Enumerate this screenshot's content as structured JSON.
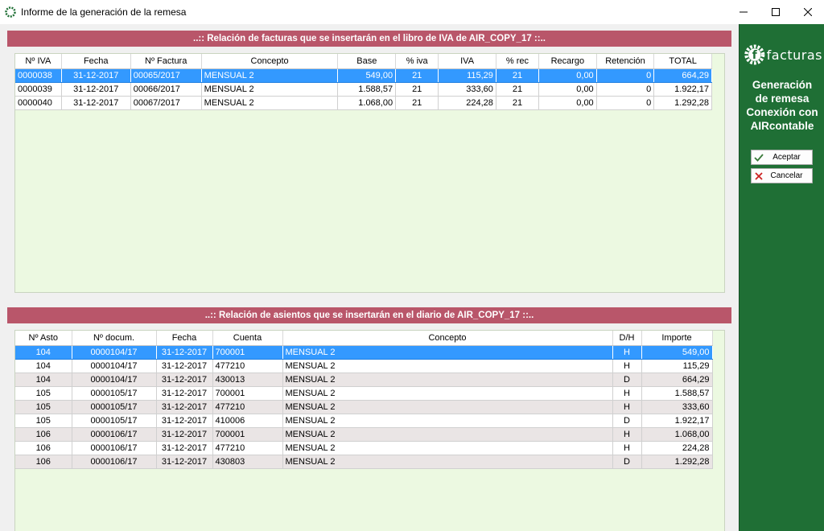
{
  "window": {
    "title": "Informe de la generación de la remesa",
    "controls": [
      "minimize",
      "maximize",
      "close"
    ]
  },
  "facturas_section": {
    "header": "..:: Relación de facturas que se insertarán en el libro de IVA de AIR_COPY_17 ::..",
    "columns": [
      "Nº IVA",
      "Fecha",
      "Nº Factura",
      "Concepto",
      "Base",
      "% iva",
      "IVA",
      "% rec",
      "Recargo",
      "Retención",
      "TOTAL"
    ],
    "rows": [
      {
        "num_iva": "0000038",
        "fecha": "31-12-2017",
        "num_factura": "00065/2017",
        "concepto": "MENSUAL 2",
        "base": "549,00",
        "pct_iva": "21",
        "iva": "115,29",
        "pct_rec": "21",
        "recargo": "0,00",
        "retencion": "0",
        "total": "664,29",
        "selected": true
      },
      {
        "num_iva": "0000039",
        "fecha": "31-12-2017",
        "num_factura": "00066/2017",
        "concepto": "MENSUAL 2",
        "base": "1.588,57",
        "pct_iva": "21",
        "iva": "333,60",
        "pct_rec": "21",
        "recargo": "0,00",
        "retencion": "0",
        "total": "1.922,17",
        "selected": false
      },
      {
        "num_iva": "0000040",
        "fecha": "31-12-2017",
        "num_factura": "00067/2017",
        "concepto": "MENSUAL 2",
        "base": "1.068,00",
        "pct_iva": "21",
        "iva": "224,28",
        "pct_rec": "21",
        "recargo": "0,00",
        "retencion": "0",
        "total": "1.292,28",
        "selected": false
      }
    ]
  },
  "asientos_section": {
    "header": "..:: Relación de asientos que se insertarán en el diario de AIR_COPY_17 ::..",
    "columns": [
      "Nº Asto",
      "Nº docum.",
      "Fecha",
      "Cuenta",
      "Concepto",
      "D/H",
      "Importe"
    ],
    "rows": [
      {
        "asto": "104",
        "docum": "0000104/17",
        "fecha": "31-12-2017",
        "cuenta": "700001",
        "concepto": "MENSUAL 2",
        "dh": "H",
        "importe": "549,00",
        "selected": true
      },
      {
        "asto": "104",
        "docum": "0000104/17",
        "fecha": "31-12-2017",
        "cuenta": "477210",
        "concepto": "MENSUAL 2",
        "dh": "H",
        "importe": "115,29",
        "selected": false
      },
      {
        "asto": "104",
        "docum": "0000104/17",
        "fecha": "31-12-2017",
        "cuenta": "430013",
        "concepto": "MENSUAL 2",
        "dh": "D",
        "importe": "664,29",
        "selected": false
      },
      {
        "asto": "105",
        "docum": "0000105/17",
        "fecha": "31-12-2017",
        "cuenta": "700001",
        "concepto": "MENSUAL 2",
        "dh": "H",
        "importe": "1.588,57",
        "selected": false
      },
      {
        "asto": "105",
        "docum": "0000105/17",
        "fecha": "31-12-2017",
        "cuenta": "477210",
        "concepto": "MENSUAL 2",
        "dh": "H",
        "importe": "333,60",
        "selected": false
      },
      {
        "asto": "105",
        "docum": "0000105/17",
        "fecha": "31-12-2017",
        "cuenta": "410006",
        "concepto": "MENSUAL 2",
        "dh": "D",
        "importe": "1.922,17",
        "selected": false
      },
      {
        "asto": "106",
        "docum": "0000106/17",
        "fecha": "31-12-2017",
        "cuenta": "700001",
        "concepto": "MENSUAL 2",
        "dh": "H",
        "importe": "1.068,00",
        "selected": false
      },
      {
        "asto": "106",
        "docum": "0000106/17",
        "fecha": "31-12-2017",
        "cuenta": "477210",
        "concepto": "MENSUAL 2",
        "dh": "H",
        "importe": "224,28",
        "selected": false
      },
      {
        "asto": "106",
        "docum": "0000106/17",
        "fecha": "31-12-2017",
        "cuenta": "430803",
        "concepto": "MENSUAL 2",
        "dh": "D",
        "importe": "1.292,28",
        "selected": false
      }
    ]
  },
  "sidebar": {
    "logo_text": "facturas",
    "title_lines": [
      "Generación",
      "de remesa",
      "Conexión con",
      "AIRcontable"
    ],
    "accept_label": "Aceptar",
    "cancel_label": "Cancelar",
    "accept_icon": "checkmark-icon",
    "cancel_icon": "x-icon"
  },
  "colors": {
    "header_bar": "#b9566a",
    "sidebar": "#1f6f35",
    "selection": "#3399ff",
    "grid_bg": "#ecf9e1",
    "alt_row": "#eae5e5"
  }
}
